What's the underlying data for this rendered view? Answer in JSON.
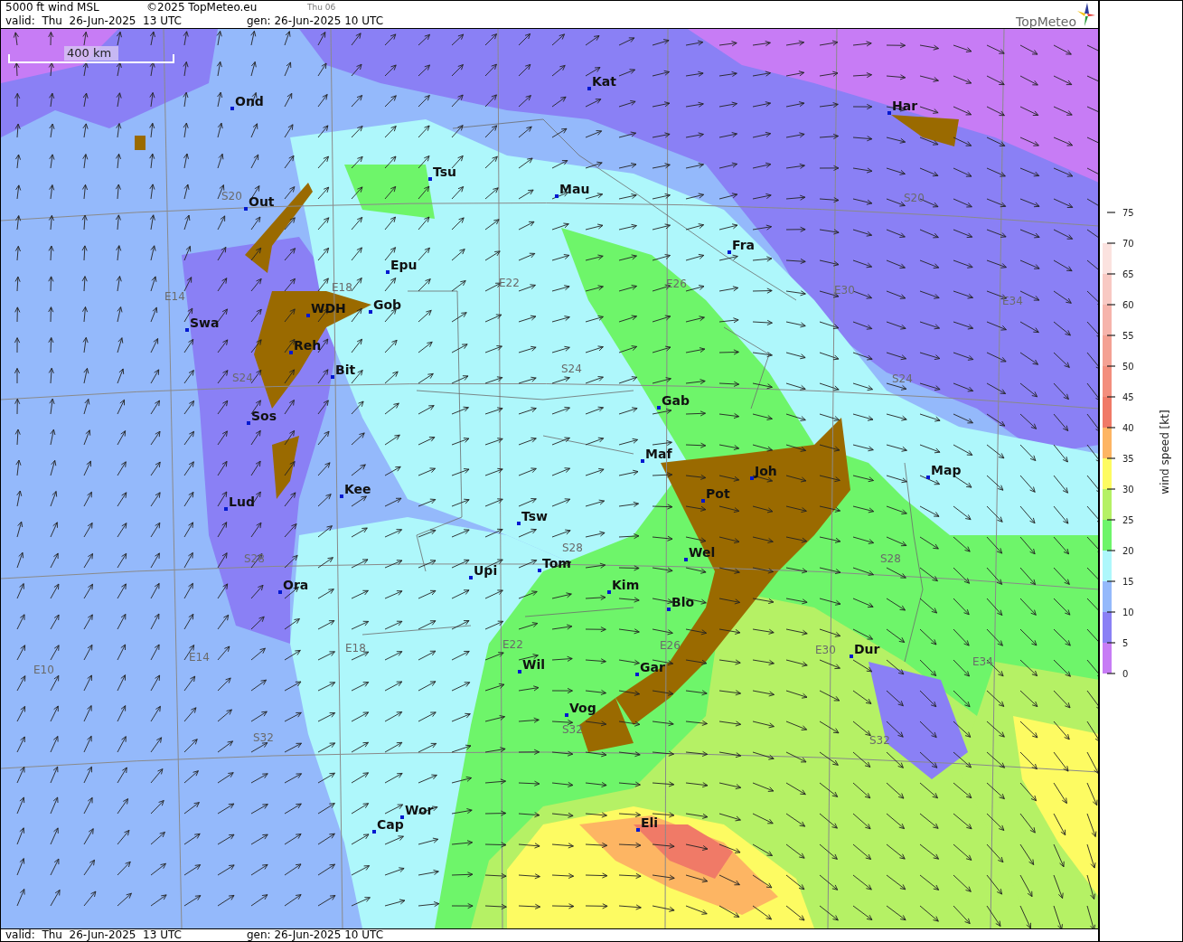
{
  "header": {
    "title": "5000 ft wind MSL",
    "copyright": "©2025 TopMeteo.eu",
    "day_code": "Thu 06",
    "valid": "valid:  Thu  26-Jun-2025  13 UTC",
    "generated": "gen: 26-Jun-2025 10 UTC",
    "logo": "TopMeteo"
  },
  "map": {
    "scale_label": "400 km",
    "cities": [
      "Ond",
      "Kat",
      "Har",
      "Tsu",
      "Mau",
      "Out",
      "Fra",
      "Epu",
      "Gob",
      "WDH",
      "Swa",
      "Reh",
      "Bit",
      "Gab",
      "Sos",
      "Maf",
      "Joh",
      "Map",
      "Pot",
      "Kee",
      "Lud",
      "Tsw",
      "Wel",
      "Tom",
      "Upi",
      "Kim",
      "Ora",
      "Blo",
      "Dur",
      "Wil",
      "Gar",
      "Vog",
      "Wor",
      "Cap",
      "Eli"
    ],
    "grid_labels": [
      "S20",
      "S20",
      "E14",
      "E18",
      "E22",
      "E26",
      "E30",
      "E34",
      "S24",
      "S24",
      "S24",
      "S28",
      "S28",
      "S28",
      "E10",
      "E14",
      "E18",
      "E22",
      "E26",
      "E30",
      "E34",
      "S32",
      "S32",
      "S32"
    ]
  },
  "legend": {
    "title": "wind speed [kt]",
    "ticks": [
      "75",
      "70",
      "65",
      "60",
      "55",
      "50",
      "45",
      "40",
      "35",
      "30",
      "25",
      "20",
      "15",
      "10",
      "5",
      "0"
    ],
    "bands": [
      {
        "color": "#fbe2df"
      },
      {
        "color": "#f8c9c3"
      },
      {
        "color": "#f6b4ab"
      },
      {
        "color": "#f4a193"
      },
      {
        "color": "#f38e7d"
      },
      {
        "color": "#f07a67"
      },
      {
        "color": "#fdb563"
      },
      {
        "color": "#fdfb62"
      },
      {
        "color": "#b5f165"
      },
      {
        "color": "#6ef56a"
      },
      {
        "color": "#aef7fb"
      },
      {
        "color": "#94b9fb"
      },
      {
        "color": "#8a80f5"
      },
      {
        "color": "#c77cf5"
      }
    ]
  },
  "footer": {
    "valid": "valid:  Thu  26-Jun-2025  13 UTC",
    "generated": "gen: 26-Jun-2025 10 UTC"
  }
}
